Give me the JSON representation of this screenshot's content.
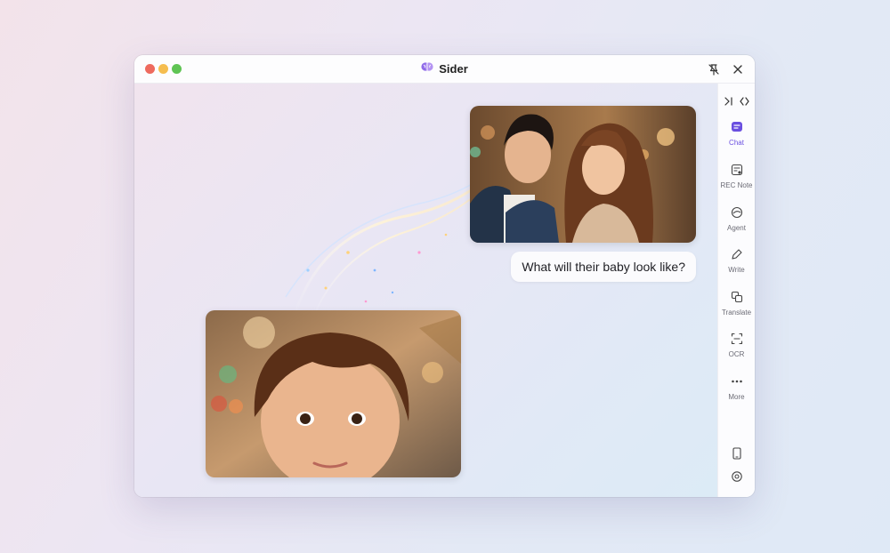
{
  "window": {
    "title": "Sider"
  },
  "chat": {
    "user_message": "What will their baby look like?",
    "user_image": "couple-photo",
    "result_image": "baby-photo"
  },
  "sidebar": {
    "items": [
      {
        "label": "Chat",
        "icon": "chat-icon",
        "active": true
      },
      {
        "label": "REC Note",
        "icon": "rec-note-icon"
      },
      {
        "label": "Agent",
        "icon": "agent-icon"
      },
      {
        "label": "Write",
        "icon": "write-icon"
      },
      {
        "label": "Translate",
        "icon": "translate-icon"
      },
      {
        "label": "OCR",
        "icon": "ocr-icon"
      },
      {
        "label": "More",
        "icon": "more-icon"
      }
    ]
  },
  "colors": {
    "accent": "#6a4fe0",
    "traffic_red": "#ee6a5e",
    "traffic_yellow": "#f5bd4f",
    "traffic_green": "#5fc454"
  }
}
